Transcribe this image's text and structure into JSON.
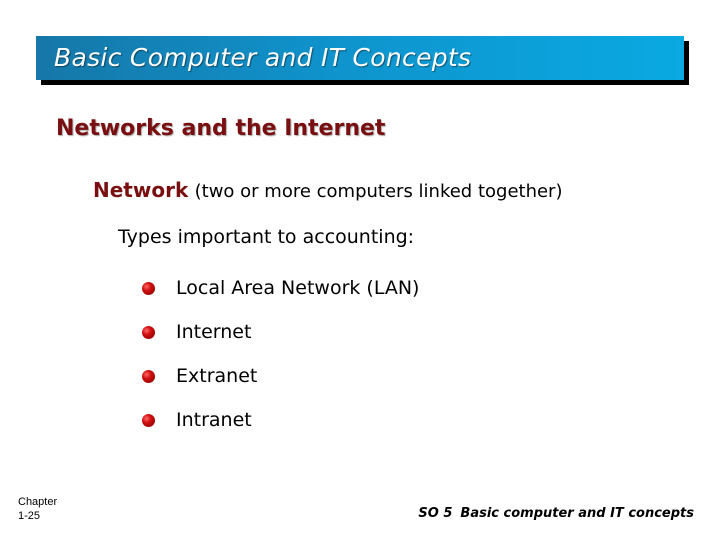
{
  "slide": {
    "title": "Basic Computer and IT Concepts",
    "section_heading": "Networks and the Internet",
    "network_term": "Network",
    "network_definition": "(two or more computers linked together)",
    "types_intro": "Types important to accounting:",
    "network_types": [
      "Local Area Network (LAN)",
      "Internet",
      "Extranet",
      "Intranet"
    ]
  },
  "footer": {
    "chapter_label": "Chapter",
    "page_number": "1-25",
    "study_objective": "SO 5",
    "study_objective_text": "Basic computer and IT concepts"
  },
  "colors": {
    "title_bar_start": "#1677a8",
    "title_bar_end": "#0aa9e2",
    "heading_maroon": "#7a0f12",
    "bullet_red": "#d01010"
  }
}
